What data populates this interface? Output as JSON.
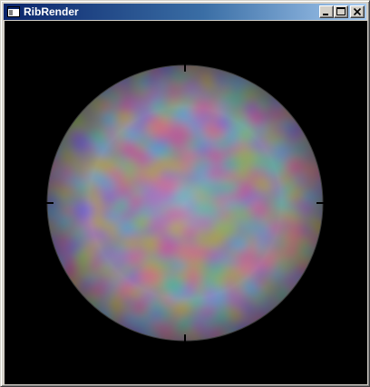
{
  "window": {
    "title": "RibRender",
    "app_icon": "window-app-icon",
    "controls": {
      "minimize_icon": "minimize-icon",
      "maximize_icon": "maximize-icon",
      "close_icon": "close-icon"
    }
  },
  "render": {
    "background_color": "#000000",
    "object": "sphere",
    "texture": "multicolor-noise",
    "palette": [
      "#c05aa0",
      "#5ab0a0",
      "#7a6ad0",
      "#90b060",
      "#d0708a",
      "#60a0d0",
      "#b0a050",
      "#a070c0"
    ]
  },
  "colors": {
    "titlebar_start": "#0a246a",
    "titlebar_end": "#a6caf0",
    "chrome": "#d4d0c8"
  }
}
